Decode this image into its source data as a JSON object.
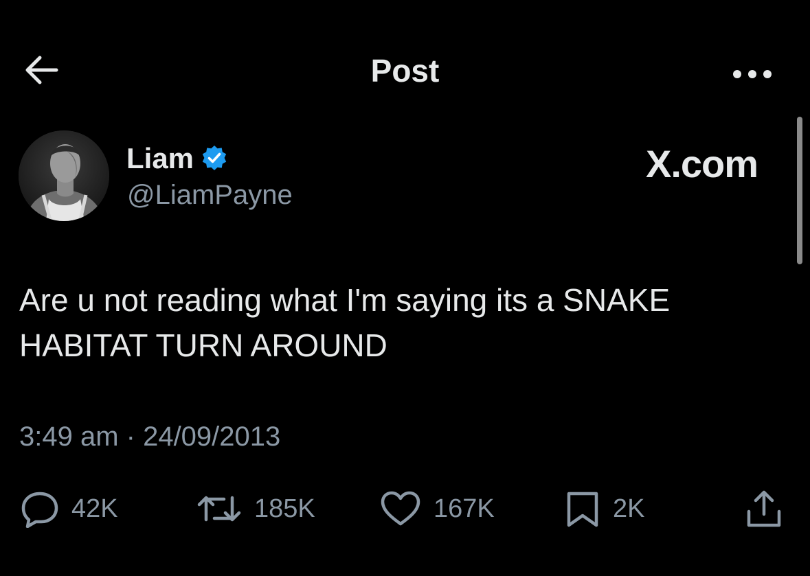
{
  "header": {
    "title": "Post",
    "back_icon": "arrow-left-icon",
    "more_icon": "more-horizontal-icon"
  },
  "author": {
    "display_name": "Liam",
    "handle": "@LiamPayne",
    "verified": true,
    "verified_color": "#1d9bf0"
  },
  "source": {
    "label": "X.com"
  },
  "post": {
    "text": "Are u not reading what I'm saying its a SNAKE\nHABITAT TURN AROUND",
    "timestamp": "3:49 am · 24/09/2013"
  },
  "actions": {
    "replies": "42K",
    "reposts": "185K",
    "likes": "167K",
    "bookmarks": "2K"
  },
  "colors": {
    "background": "#000000",
    "text_primary": "#e7e9ea",
    "text_secondary": "#8b98a5"
  }
}
